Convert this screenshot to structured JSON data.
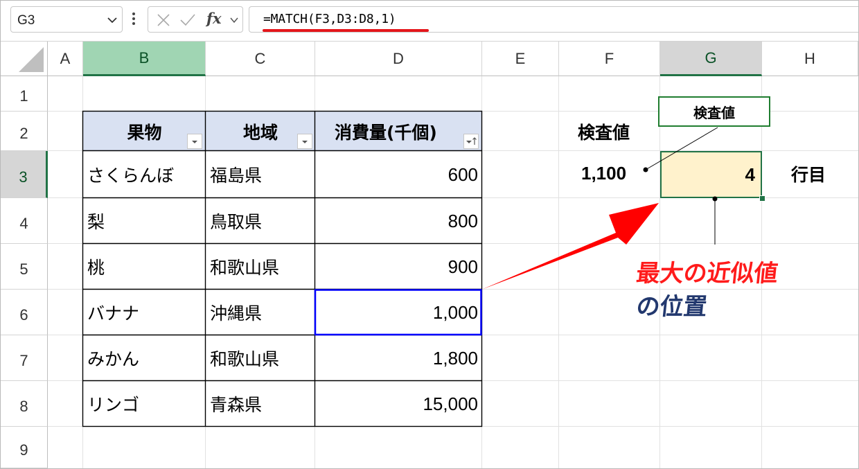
{
  "formula_bar": {
    "name_box": "G3",
    "formula": "=MATCH(F3,D3:D8,1)",
    "fx_label": "fx"
  },
  "columns": [
    "A",
    "B",
    "C",
    "D",
    "E",
    "F",
    "G",
    "H"
  ],
  "rows": [
    "1",
    "2",
    "3",
    "4",
    "5",
    "6",
    "7",
    "8",
    "9"
  ],
  "selection": {
    "active_cell": "G3",
    "highlight_color": "#217346"
  },
  "table": {
    "headers": [
      "果物",
      "地域",
      "消費量(千個)"
    ],
    "rows": [
      [
        "さくらんぼ",
        "福島県",
        "600"
      ],
      [
        "梨",
        "鳥取県",
        "800"
      ],
      [
        "桃",
        "和歌山県",
        "900"
      ],
      [
        "バナナ",
        "沖縄県",
        "1,000"
      ],
      [
        "みかん",
        "和歌山県",
        "1,800"
      ],
      [
        "リンゴ",
        "青森県",
        "15,000"
      ]
    ],
    "header_fill": "#d9e1f2",
    "matched_border_color": "#0000ff"
  },
  "lookup": {
    "label": "検査値",
    "value": "1,100",
    "result": "4",
    "result_suffix": "行目",
    "result_fill": "#fff2cc"
  },
  "annotations": {
    "callout": "検査値",
    "line1": "最大の近似値",
    "line2": "の位置",
    "line1_color": "#ff1b1b",
    "line2_color": "#22386e",
    "arrow_color": "#ff0000"
  }
}
